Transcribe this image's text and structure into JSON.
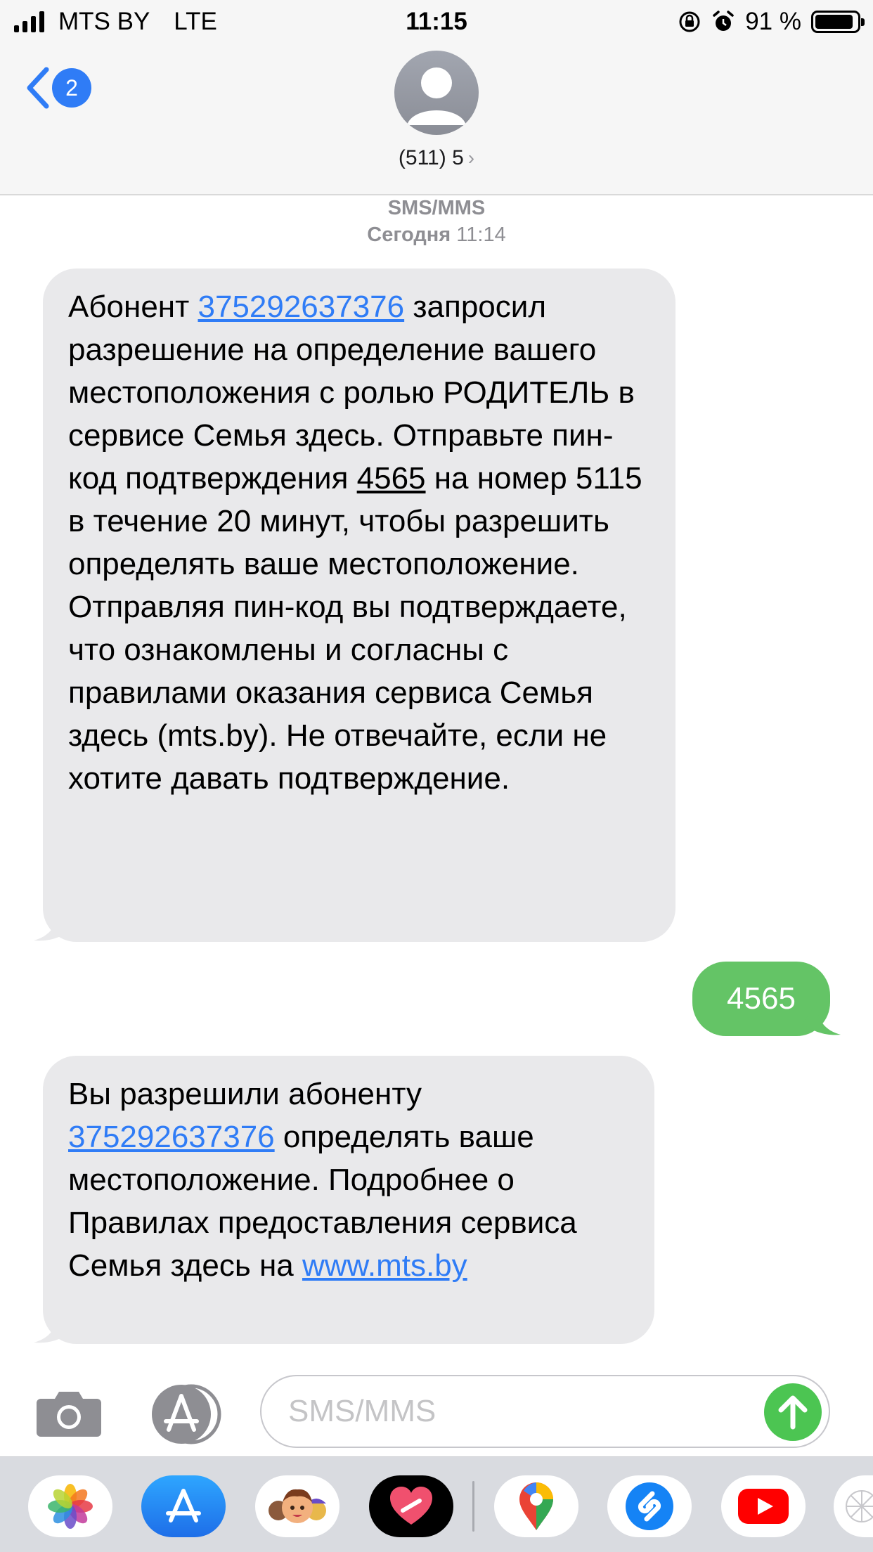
{
  "status_bar": {
    "carrier": "MTS BY",
    "network": "LTE",
    "time": "11:15",
    "battery": "91 %",
    "battery_level": 0.91
  },
  "header": {
    "back_badge": "2",
    "contact": "(511) 5"
  },
  "conversation": {
    "service": "SMS/MMS",
    "date_label": "Сегодня",
    "date_time": "11:14"
  },
  "messages": {
    "m1": {
      "p1": "Абонент ",
      "link": "375292637376",
      "p2": " запросил разрешение на определение вашего местоположения с ролью РОДИТЕЛЬ в сервисе Семья здесь. Отправьте пин-код подтверждения ",
      "code": "4565",
      "p3": " на номер 5115 в течение 20 минут, чтобы разрешить определять ваше местоположение. Отправляя пин-код вы подтверждаете, что ознакомлены и согласны с правилами оказания сервиса Семья здесь (mts.by). Не отвечайте, если не хотите давать подтверждение."
    },
    "m2": {
      "text": "4565"
    },
    "m3": {
      "p1": "Вы разрешили абоненту ",
      "link": "375292637376",
      "p2": " определять ваше местоположение. Подробнее о Правилах предоставления сервиса Семья здесь на ",
      "url": "www.mts.by"
    }
  },
  "input": {
    "placeholder": "SMS/MMS"
  },
  "app_drawer": {
    "apps": [
      "photos-icon",
      "app-store-icon",
      "memoji-icon",
      "digital-touch-icon",
      "google-maps-icon",
      "shazam-icon",
      "youtube-icon",
      "more-apps-icon"
    ]
  },
  "colors": {
    "link": "#2f7cf6",
    "incoming_bubble": "#e9e9eb",
    "outgoing_bubble": "#64c466",
    "send_button": "#4cc552"
  }
}
